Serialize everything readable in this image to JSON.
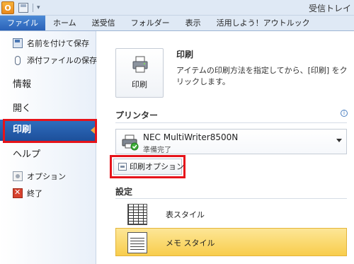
{
  "titlebar": {
    "app_letter": "O",
    "window_title": "受信トレイ"
  },
  "ribbon": {
    "tabs": [
      {
        "label": "ファイル"
      },
      {
        "label": "ホーム"
      },
      {
        "label": "送受信"
      },
      {
        "label": "フォルダー"
      },
      {
        "label": "表示"
      },
      {
        "label": "活用しよう！アウトルック"
      }
    ]
  },
  "nav": {
    "save_as": "名前を付けて保存",
    "save_attachments": "添付ファイルの保存",
    "info": "情報",
    "open": "開く",
    "print": "印刷",
    "help": "ヘルプ",
    "options": "オプション",
    "exit": "終了"
  },
  "print": {
    "button_label": "印刷",
    "title": "印刷",
    "description": "アイテムの印刷方法を指定してから、[印刷] をクリックします。"
  },
  "printer": {
    "section_title": "プリンター",
    "name": "NEC MultiWriter8500N",
    "status": "準備完了",
    "options_button": "印刷オプション"
  },
  "settings": {
    "section_title": "設定",
    "styles": [
      {
        "label": "表スタイル",
        "selected": false
      },
      {
        "label": "メモ スタイル",
        "selected": true
      }
    ]
  },
  "colors": {
    "highlight_border": "#e6131a",
    "nav_selected": "#2f6fc0",
    "selected_style": "#f8cd4c"
  }
}
